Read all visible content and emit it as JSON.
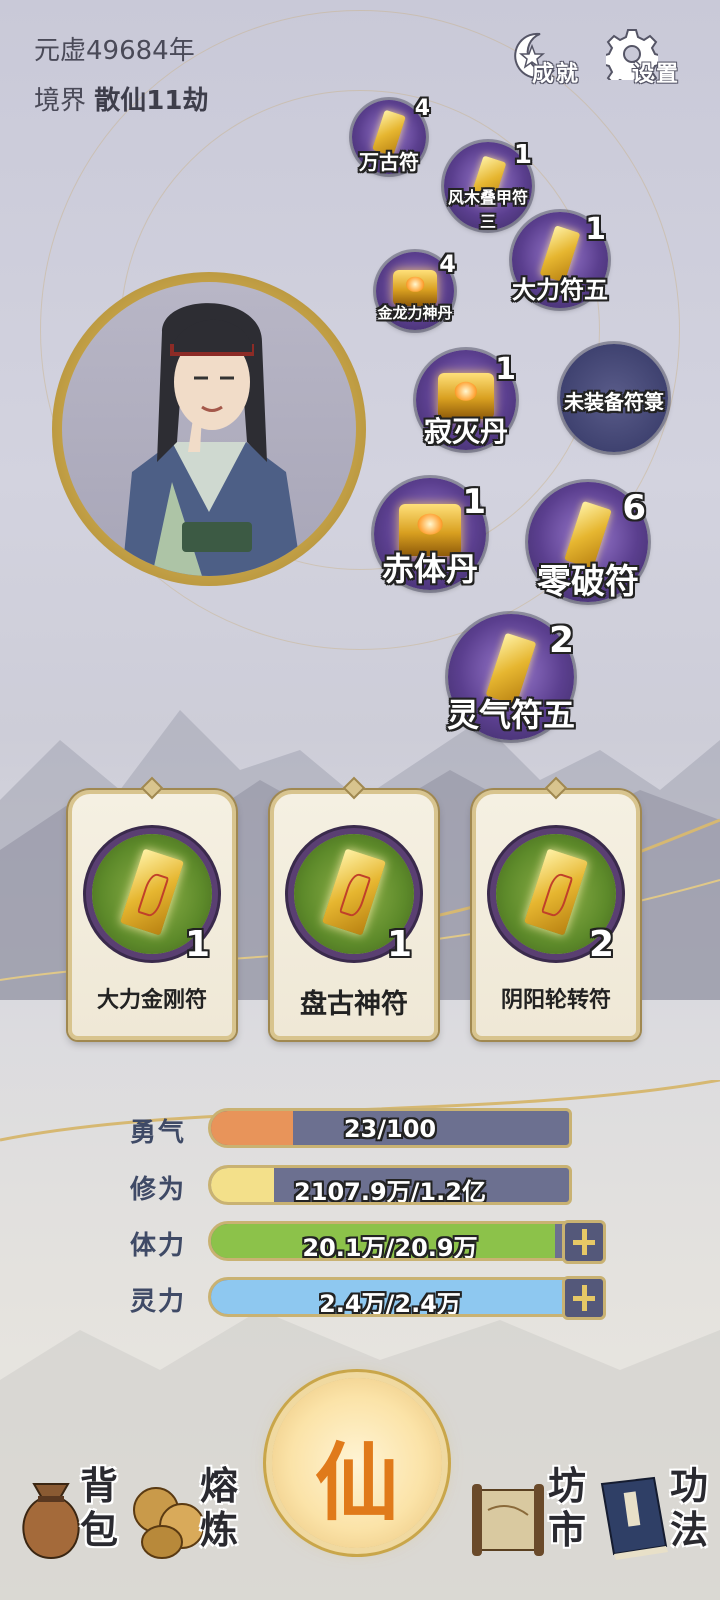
{
  "header": {
    "era": "元虚49684年",
    "realm_label": "境界",
    "realm_value": "散仙11劫",
    "achievements_label": "成就",
    "settings_label": "设置"
  },
  "bubbles": [
    {
      "name": "万古符",
      "count": "4",
      "kind": "talisman"
    },
    {
      "name": "风木叠甲符三",
      "name_line1": "风木叠甲符",
      "name_line2": "三",
      "count": "1",
      "kind": "talisman"
    },
    {
      "name": "大力符五",
      "count": "1",
      "kind": "talisman"
    },
    {
      "name": "金龙力神丹",
      "count": "4",
      "kind": "pill"
    },
    {
      "name": "寂灭丹",
      "count": "1",
      "kind": "pill"
    },
    {
      "name": "未装备符箓",
      "count": "",
      "kind": "empty"
    },
    {
      "name": "赤体丹",
      "count": "1",
      "kind": "pill"
    },
    {
      "name": "零破符",
      "count": "6",
      "kind": "talisman"
    },
    {
      "name": "灵气符五",
      "count": "2",
      "kind": "talisman"
    }
  ],
  "cards": [
    {
      "name": "大力金刚符",
      "count": "1"
    },
    {
      "name": "盘古神符",
      "count": "1"
    },
    {
      "name": "阴阳轮转符",
      "count": "2"
    }
  ],
  "stats": {
    "courage": {
      "label": "勇气",
      "text": "23/100",
      "fraction": 0.23,
      "color": "#e8945a"
    },
    "cultivation": {
      "label": "修为",
      "text": "2107.9万/1.2亿",
      "fraction": 0.176,
      "color": "#f3e08a"
    },
    "stamina": {
      "label": "体力",
      "text": "20.1万/20.9万",
      "fraction": 0.962,
      "color": "#8cc24a"
    },
    "spirit": {
      "label": "灵力",
      "text": "2.4万/2.4万",
      "fraction": 1.0,
      "color": "#8ec8f0"
    }
  },
  "nav": {
    "center": "仙",
    "bag": "背包",
    "bag_c1": "背",
    "bag_c2": "包",
    "smelt": "熔炼",
    "smelt_c1": "熔",
    "smelt_c2": "炼",
    "market": "坊市",
    "market_c1": "坊",
    "market_c2": "市",
    "technique": "功法",
    "technique_c1": "功",
    "technique_c2": "法"
  }
}
